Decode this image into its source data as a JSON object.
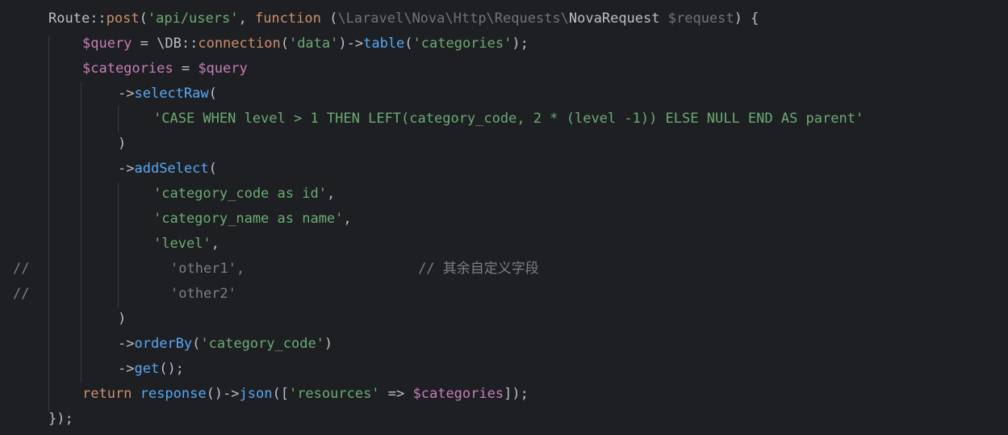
{
  "editor": {
    "colors": {
      "background": "#1e1f22",
      "keyword": "#cf8e6d",
      "function": "#56a8f5",
      "string": "#6aab73",
      "variable": "#c77dbb",
      "namespace": "#6f737a",
      "comment": "#7a7e85",
      "text": "#bcbec4"
    },
    "lines": [
      {
        "indent": 0,
        "tokens": [
          {
            "t": "Route",
            "c": "cls"
          },
          {
            "t": "::",
            "c": "plain"
          },
          {
            "t": "post",
            "c": "kw"
          },
          {
            "t": "(",
            "c": "plain"
          },
          {
            "t": "'api/users'",
            "c": "str"
          },
          {
            "t": ", ",
            "c": "plain"
          },
          {
            "t": "function",
            "c": "kw"
          },
          {
            "t": " (",
            "c": "plain"
          },
          {
            "t": "\\Laravel\\Nova\\Http\\Requests\\",
            "c": "ns"
          },
          {
            "t": "NovaRequest",
            "c": "cls"
          },
          {
            "t": " ",
            "c": "plain"
          },
          {
            "t": "$request",
            "c": "ns"
          },
          {
            "t": ") {",
            "c": "plain"
          }
        ]
      },
      {
        "indent": 1,
        "tokens": [
          {
            "t": "$query",
            "c": "var"
          },
          {
            "t": " = \\",
            "c": "plain"
          },
          {
            "t": "DB",
            "c": "cls"
          },
          {
            "t": "::",
            "c": "plain"
          },
          {
            "t": "connection",
            "c": "kw"
          },
          {
            "t": "(",
            "c": "plain"
          },
          {
            "t": "'data'",
            "c": "str"
          },
          {
            "t": ")->",
            "c": "plain"
          },
          {
            "t": "table",
            "c": "fn"
          },
          {
            "t": "(",
            "c": "plain"
          },
          {
            "t": "'categories'",
            "c": "str"
          },
          {
            "t": ");",
            "c": "plain"
          }
        ]
      },
      {
        "indent": 1,
        "tokens": [
          {
            "t": "$categories",
            "c": "var"
          },
          {
            "t": " = ",
            "c": "plain"
          },
          {
            "t": "$query",
            "c": "var"
          }
        ]
      },
      {
        "indent": 2,
        "tokens": [
          {
            "t": "->",
            "c": "plain"
          },
          {
            "t": "selectRaw",
            "c": "fn"
          },
          {
            "t": "(",
            "c": "plain"
          }
        ]
      },
      {
        "indent": 3,
        "tokens": [
          {
            "t": "'CASE WHEN level > 1 THEN LEFT(category_code, 2 * (level -1)) ELSE NULL END AS parent'",
            "c": "str"
          }
        ]
      },
      {
        "indent": 2,
        "tokens": [
          {
            "t": ")",
            "c": "plain"
          }
        ]
      },
      {
        "indent": 2,
        "tokens": [
          {
            "t": "->",
            "c": "plain"
          },
          {
            "t": "addSelect",
            "c": "fn"
          },
          {
            "t": "(",
            "c": "plain"
          }
        ]
      },
      {
        "indent": 3,
        "tokens": [
          {
            "t": "'category_code as id'",
            "c": "str"
          },
          {
            "t": ",",
            "c": "plain"
          }
        ]
      },
      {
        "indent": 3,
        "tokens": [
          {
            "t": "'category_name as name'",
            "c": "str"
          },
          {
            "t": ",",
            "c": "plain"
          }
        ]
      },
      {
        "indent": 3,
        "tokens": [
          {
            "t": "'level'",
            "c": "str"
          },
          {
            "t": ",",
            "c": "plain"
          }
        ]
      },
      {
        "indent": 0,
        "commented": true,
        "marker": "//",
        "tokens": [
          {
            "t": "'other1'",
            "c": "cmt"
          },
          {
            "t": ",",
            "c": "cmt"
          },
          {
            "t": "                     // ",
            "c": "cmt"
          },
          {
            "t": "其余自定义字段",
            "c": "cmt-cjk"
          }
        ]
      },
      {
        "indent": 0,
        "commented": true,
        "marker": "//",
        "tokens": [
          {
            "t": "'other2'",
            "c": "cmt"
          }
        ]
      },
      {
        "indent": 2,
        "tokens": [
          {
            "t": ")",
            "c": "plain"
          }
        ]
      },
      {
        "indent": 2,
        "tokens": [
          {
            "t": "->",
            "c": "plain"
          },
          {
            "t": "orderBy",
            "c": "fn"
          },
          {
            "t": "(",
            "c": "plain"
          },
          {
            "t": "'category_code'",
            "c": "str"
          },
          {
            "t": ")",
            "c": "plain"
          }
        ]
      },
      {
        "indent": 2,
        "tokens": [
          {
            "t": "->",
            "c": "plain"
          },
          {
            "t": "get",
            "c": "fn"
          },
          {
            "t": "();",
            "c": "plain"
          }
        ]
      },
      {
        "indent": 1,
        "tokens": [
          {
            "t": "return",
            "c": "kw"
          },
          {
            "t": " ",
            "c": "plain"
          },
          {
            "t": "response",
            "c": "fn"
          },
          {
            "t": "()->",
            "c": "plain"
          },
          {
            "t": "json",
            "c": "fn"
          },
          {
            "t": "([",
            "c": "plain"
          },
          {
            "t": "'resources'",
            "c": "str"
          },
          {
            "t": " => ",
            "c": "plain"
          },
          {
            "t": "$categories",
            "c": "var"
          },
          {
            "t": "]);",
            "c": "plain"
          }
        ]
      },
      {
        "indent": 0,
        "tokens": [
          {
            "t": "});",
            "c": "plain"
          }
        ]
      }
    ]
  }
}
